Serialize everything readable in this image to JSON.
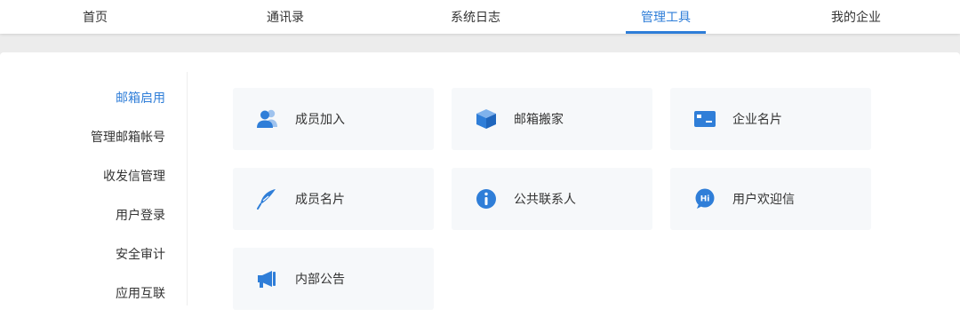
{
  "nav": {
    "tabs": [
      {
        "label": "首页"
      },
      {
        "label": "通讯录"
      },
      {
        "label": "系统日志"
      },
      {
        "label": "管理工具",
        "active": true
      },
      {
        "label": "我的企业"
      }
    ]
  },
  "sidebar": {
    "items": [
      {
        "label": "邮箱启用",
        "active": true
      },
      {
        "label": "管理邮箱帐号"
      },
      {
        "label": "收发信管理"
      },
      {
        "label": "用户登录"
      },
      {
        "label": "安全审计"
      },
      {
        "label": "应用互联"
      }
    ]
  },
  "tools": [
    {
      "label": "成员加入",
      "icon": "members-icon"
    },
    {
      "label": "邮箱搬家",
      "icon": "box-icon"
    },
    {
      "label": "企业名片",
      "icon": "id-card-icon"
    },
    {
      "label": "成员名片",
      "icon": "feather-icon"
    },
    {
      "label": "公共联系人",
      "icon": "info-icon"
    },
    {
      "label": "用户欢迎信",
      "icon": "hi-bubble-icon"
    },
    {
      "label": "内部公告",
      "icon": "megaphone-icon"
    }
  ],
  "colors": {
    "accent": "#2f7ed8",
    "card_bg": "#f6f8fa",
    "page_bg": "#ececec"
  }
}
